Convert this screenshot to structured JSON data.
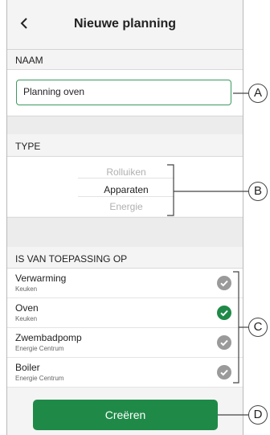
{
  "header": {
    "title": "Nieuwe planning",
    "back_icon": "chevron-left-icon"
  },
  "naam": {
    "label": "NAAM",
    "value": "Planning oven"
  },
  "type": {
    "label": "TYPE",
    "options": [
      "Rolluiken",
      "Apparaten",
      "Energie"
    ],
    "selected": "Apparaten"
  },
  "applies": {
    "label": "IS VAN TOEPASSING OP",
    "items": [
      {
        "title": "Verwarming",
        "subtitle": "Keuken",
        "checked": false
      },
      {
        "title": "Oven",
        "subtitle": "Keuken",
        "checked": true
      },
      {
        "title": "Zwembadpomp",
        "subtitle": "Energie Centrum",
        "checked": false
      },
      {
        "title": "Boiler",
        "subtitle": "Energie Centrum",
        "checked": false
      }
    ]
  },
  "create_button": {
    "label": "Creëren"
  },
  "callouts": [
    "A",
    "B",
    "C",
    "D"
  ],
  "colors": {
    "accent": "#1f8a48",
    "check_on": "#1f8a48",
    "check_off": "#9a9a9a"
  }
}
